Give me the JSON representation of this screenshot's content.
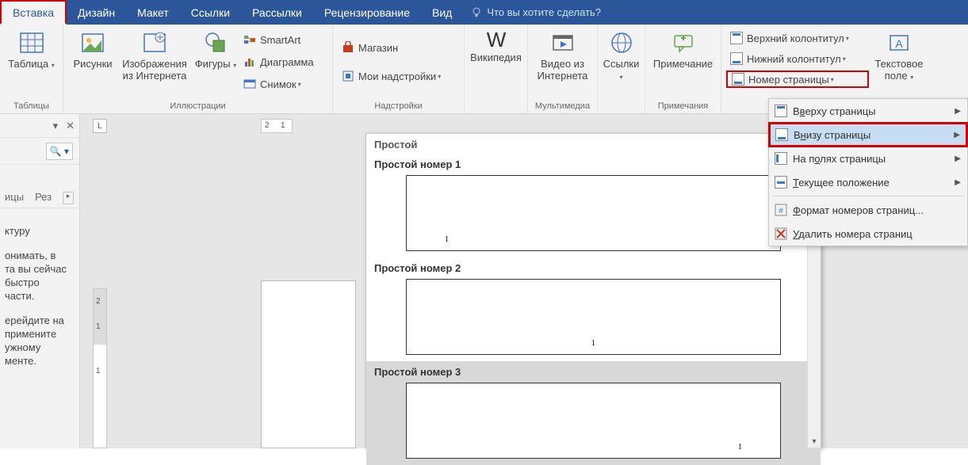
{
  "tabs": [
    "Вставка",
    "Дизайн",
    "Макет",
    "Ссылки",
    "Рассылки",
    "Рецензирование",
    "Вид"
  ],
  "tellme": "Что вы хотите сделать?",
  "ribbon": {
    "tables": {
      "label": "Таблицы",
      "table": "Таблица"
    },
    "illustrations": {
      "label": "Иллюстрации",
      "pictures": "Рисунки",
      "online_pictures": "Изображения\nиз Интернета",
      "shapes": "Фигуры",
      "smartart": "SmartArt",
      "chart": "Диаграмма",
      "screenshot": "Снимок"
    },
    "addins": {
      "label": "Надстройки",
      "store": "Магазин",
      "myaddins": "Мои надстройки"
    },
    "wikipedia": "Википедия",
    "media": {
      "label": "Мультимедиа",
      "video": "Видео из\nИнтернета"
    },
    "links": "Ссылки",
    "comments": {
      "label": "Примечания",
      "comment": "Примечание"
    },
    "headerfooter": {
      "header": "Верхний колонтитул",
      "footer": "Нижний колонтитул",
      "pagenum": "Номер страницы"
    },
    "text": {
      "textbox": "Текстовое\nполе"
    }
  },
  "menu": {
    "top": "Вверху страницы",
    "bottom": "Внизу страницы",
    "margins": "На полях страницы",
    "current": "Текущее положение",
    "format": "Формат номеров страниц...",
    "remove": "Удалить номера страниц",
    "ul": {
      "top": "в",
      "bottom": "н",
      "margins": "о",
      "current": "Т",
      "format": "Ф",
      "remove": "У"
    }
  },
  "gallery": {
    "header": "Простой",
    "items": [
      {
        "title": "Простой номер 1",
        "pos": "left"
      },
      {
        "title": "Простой номер 2",
        "pos": "center"
      },
      {
        "title": "Простой номер 3",
        "pos": "right"
      }
    ],
    "sample": "1"
  },
  "nav": {
    "tab1": "ицы",
    "tab2": "Рез",
    "item1": "ктуру",
    "item2": "онимать, в\nта вы сейчас\nбыстро\nчасти.",
    "item3": "ерейдите на\nпримените\nужному\nменте."
  },
  "ruler": {
    "h": [
      "2",
      "1"
    ],
    "v": [
      "2",
      "1",
      "1"
    ]
  }
}
